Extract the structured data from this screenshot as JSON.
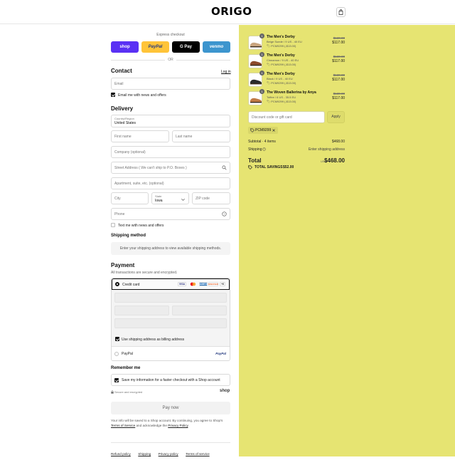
{
  "brand": {
    "logo_text": "ORIGO"
  },
  "header": {
    "cart_icon": "shopping-bag-icon"
  },
  "express": {
    "title": "Express checkout",
    "buttons": [
      {
        "label": "shop",
        "bg": "#5a31f4",
        "color": "#ffffff"
      },
      {
        "label": "PayPal",
        "bg": "#ffc439",
        "color": "#253b80"
      },
      {
        "label": "G Pay",
        "bg": "#000000",
        "color": "#ffffff"
      },
      {
        "label": "venmo",
        "bg": "#3d95ce",
        "color": "#ffffff"
      }
    ],
    "or_text": "OR"
  },
  "contact": {
    "heading": "Contact",
    "login_link": "Log in",
    "email_placeholder": "Email",
    "news_label": "Email me with news and offers",
    "news_checked": true
  },
  "delivery": {
    "heading": "Delivery",
    "country_label": "Country/Region",
    "country_value": "United States",
    "first_name": "First name",
    "last_name": "Last name",
    "company": "Company (optional)",
    "address": "Street Address ( We can't ship to P.O. Boxes )",
    "apartment": "Apartment, suite, etc. (optional)",
    "city": "City",
    "state_label": "State",
    "state_value": "Iowa",
    "zip": "ZIP code",
    "phone": "Phone",
    "text_label": "Text me with news and offers",
    "text_checked": false
  },
  "shipping_method": {
    "heading": "Shipping method",
    "notice": "Enter your shipping address to view available shipping methods."
  },
  "payment": {
    "heading": "Payment",
    "subtitle": "All transactions are secure and encrypted.",
    "credit_card_label": "Credit card",
    "card_logos": [
      {
        "text": "VISA",
        "color": "#1a1f71",
        "bg": "#ffffff"
      },
      {
        "text": "MC",
        "color": "#eb001b",
        "bg": "#ffffff"
      },
      {
        "text": "AMEX",
        "color": "#ffffff",
        "bg": "#2e77bc"
      },
      {
        "text": "DISCOVER",
        "color": "#e55c20",
        "bg": "#ffffff"
      },
      {
        "text": "+6",
        "color": "#333333",
        "bg": "#ffffff"
      }
    ],
    "billing_label": "Use shipping address as billing address",
    "billing_checked": true,
    "paypal_label": "PayPal",
    "paypal_logo": "PayPal"
  },
  "remember": {
    "heading": "Remember me",
    "save_label": "Save my information for a faster checkout with a Shop account",
    "save_checked": true,
    "secure_text": "Secure and encrypted",
    "shop_logo": "shop"
  },
  "pay_now": "Pay now",
  "legal": {
    "text_before": "Your info will be saved to a Shop account. By continuing, you agree to Shop's",
    "terms": "Terms of Service",
    "and_ack": "and acknowledge the",
    "privacy": "Privacy Policy",
    "period": "."
  },
  "footer_links": [
    "Refund policy",
    "Shipping",
    "Privacy policy",
    "Terms of service"
  ],
  "cart": {
    "items": [
      {
        "qty": "1",
        "name": "The Men's Derby",
        "variant": "Beige Suede / 9 US - 40 EU",
        "discount": "PCM9299 (-$13.00)",
        "old_price": "$130.00",
        "price": "$117.00",
        "shoe_color": "#c9a57f"
      },
      {
        "qty": "1",
        "name": "The Men's Derby",
        "variant": "Cinnamon / 9 US - 40 EU",
        "discount": "PCM9299 (-$13.00)",
        "old_price": "$130.00",
        "price": "$117.00",
        "shoe_color": "#8b4a2b"
      },
      {
        "qty": "1",
        "name": "The Men's Derby",
        "variant": "Black / 9 US - 40 EU",
        "discount": "PCM9299 (-$13.00)",
        "old_price": "$130.00",
        "price": "$117.00",
        "shoe_color": "#2a2a2a"
      },
      {
        "qty": "1",
        "name": "The Woven Ballerina by Anya",
        "variant": "Toffee / 6 US - 35.5 EU",
        "discount": "PCM9299 (-$13.00)",
        "old_price": "$130.00",
        "price": "$117.00",
        "shoe_color": "#c07a45"
      }
    ],
    "discount_placeholder": "Discount code or gift card",
    "apply_label": "Apply",
    "applied_code": "PCM9299",
    "subtotal_label": "Subtotal · 4 items",
    "subtotal_value": "$468.00",
    "shipping_label": "Shipping",
    "shipping_value": "Enter shipping address",
    "total_label": "Total",
    "currency": "USD",
    "total_value": "$468.00",
    "savings_label": "TOTAL SAVINGS",
    "savings_value": "$52.00"
  }
}
